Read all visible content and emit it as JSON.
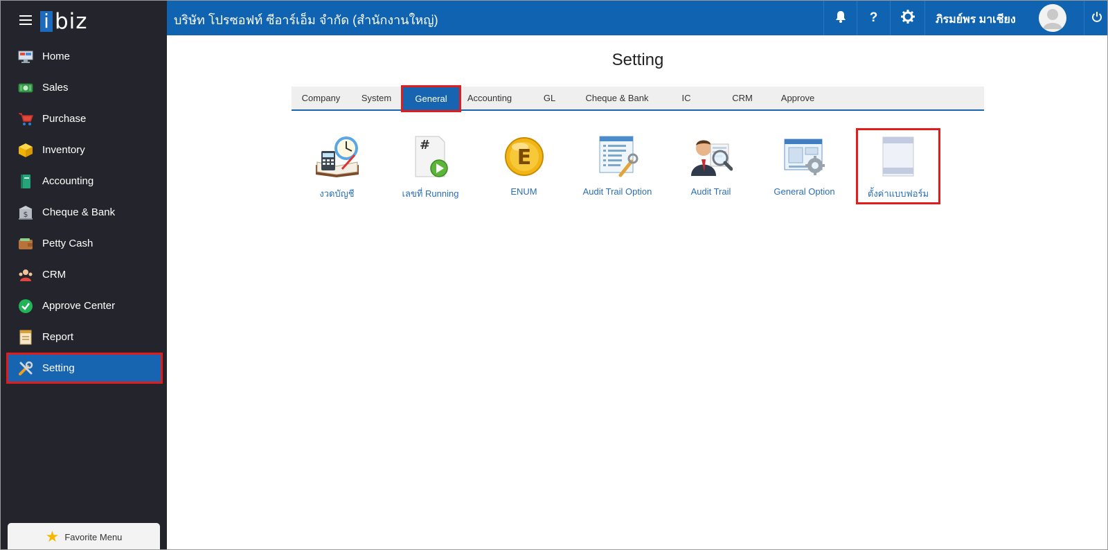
{
  "app": {
    "logo_box": "i",
    "logo_rest": "biz"
  },
  "topbar": {
    "company_name": "บริษัท โปรซอฟท์ ซีอาร์เอ็ม จำกัด (สำนักงานใหญ่)",
    "user_name": "ภิรมย์พร มาเชียง",
    "icons": [
      "bell-icon",
      "help-icon",
      "gear-icon",
      "avatar",
      "power-icon"
    ]
  },
  "sidebar": {
    "items": [
      {
        "label": "Home",
        "icon": "home-monitor-icon"
      },
      {
        "label": "Sales",
        "icon": "cash-icon"
      },
      {
        "label": "Purchase",
        "icon": "cart-icon"
      },
      {
        "label": "Inventory",
        "icon": "box-icon"
      },
      {
        "label": "Accounting",
        "icon": "book-icon"
      },
      {
        "label": "Cheque & Bank",
        "icon": "bank-icon"
      },
      {
        "label": "Petty Cash",
        "icon": "wallet-icon"
      },
      {
        "label": "CRM",
        "icon": "people-icon"
      },
      {
        "label": "Approve Center",
        "icon": "check-circle-icon"
      },
      {
        "label": "Report",
        "icon": "report-icon"
      },
      {
        "label": "Setting",
        "icon": "tools-icon",
        "active": true
      }
    ],
    "favorite_label": "Favorite Menu"
  },
  "main": {
    "title": "Setting",
    "tabs": [
      {
        "label": "Company"
      },
      {
        "label": "System"
      },
      {
        "label": "General",
        "active": true
      },
      {
        "label": "Accounting"
      },
      {
        "label": "GL"
      },
      {
        "label": "Cheque & Bank"
      },
      {
        "label": "IC"
      },
      {
        "label": "CRM"
      },
      {
        "label": "Approve"
      }
    ],
    "tiles": [
      {
        "label": "งวดบัญชี",
        "icon": "calendar-book-icon"
      },
      {
        "label": "เลขที่ Running",
        "icon": "running-number-icon"
      },
      {
        "label": "ENUM",
        "icon": "enum-coin-icon"
      },
      {
        "label": "Audit Trail Option",
        "icon": "audit-option-icon"
      },
      {
        "label": "Audit Trail",
        "icon": "audit-person-icon"
      },
      {
        "label": "General Option",
        "icon": "window-gear-icon"
      },
      {
        "label": "ตั้งค่าแบบฟอร์ม",
        "icon": "form-setting-icon",
        "highlight": true
      }
    ]
  },
  "colors": {
    "primary": "#1765b0",
    "sidebar_bg": "#24252c",
    "highlight": "#e41b1b",
    "link": "#2a6db5"
  }
}
